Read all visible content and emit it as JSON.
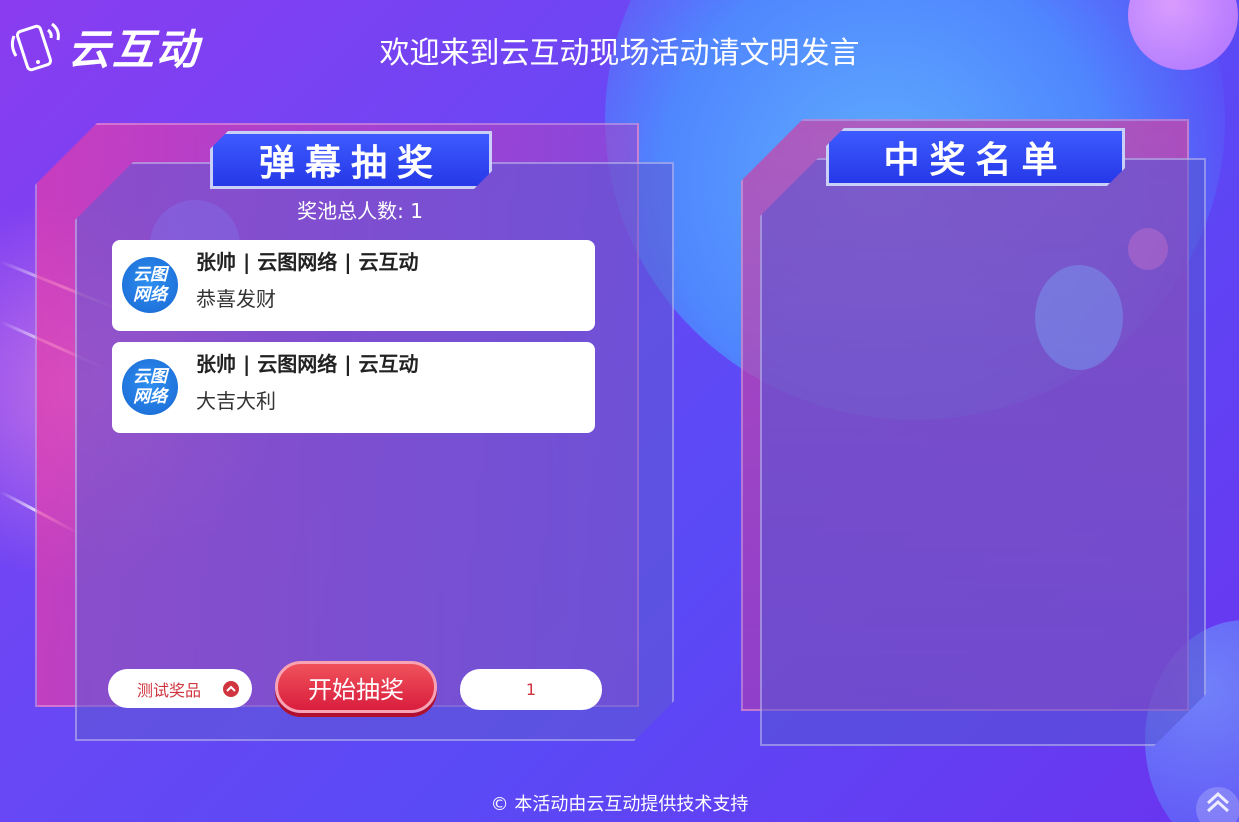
{
  "header": {
    "logo_text": "云互动",
    "title": "欢迎来到云互动现场活动请文明发言"
  },
  "lottery_panel": {
    "title": "弹幕抽奖",
    "pool_label": "奖池总人数:",
    "pool_count": "1",
    "messages": [
      {
        "name": "张帅 | 云图网络 | 云互动",
        "text": "恭喜发财",
        "avatar_line1": "云图",
        "avatar_line2": "网络"
      },
      {
        "name": "张帅 | 云图网络 | 云互动",
        "text": "大吉大利",
        "avatar_line1": "云图",
        "avatar_line2": "网络"
      }
    ],
    "prize_select": {
      "value": "测试奖品"
    },
    "start_button": "开始抽奖",
    "count_input": {
      "value": "1"
    }
  },
  "winners_panel": {
    "title": "中奖名单"
  },
  "footer": {
    "text": "© 本活动由云互动提供技术支持"
  },
  "colors": {
    "accent_red": "#d0343f",
    "title_blue": "#2638e8",
    "button_red": "#d91e3e"
  }
}
